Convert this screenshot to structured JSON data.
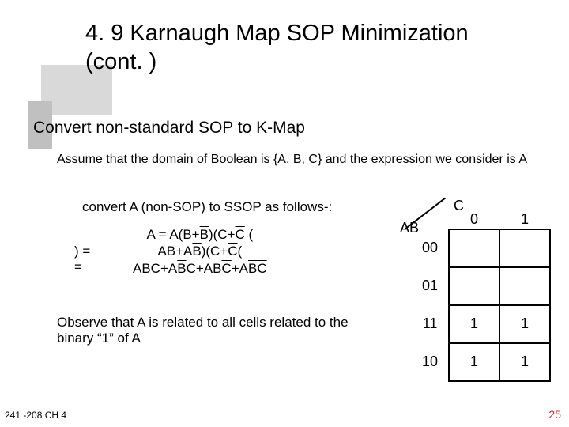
{
  "title": "4. 9 Karnaugh Map SOP Minimization (cont. )",
  "subtitle": "Convert non-standard SOP to K-Map",
  "assume": "Assume that the domain of Boolean is {A, B, C} and the expression we consider is A",
  "convert_line": "convert A (non-SOP) to SSOP as follows-:",
  "expansion": {
    "l1": ") = ",
    "l2": " =",
    "r_pre": "A = A(B+",
    "r_bar1": "B",
    "r_mid1": ")(C+",
    "r_bar2": "C",
    "r_mid15": " (",
    "r_line2a": "AB+A",
    "r_bar3": "B",
    "r_line2b": ")(C+",
    "r_bar4": "C",
    "r_line2c": "(",
    "r_line3a": "ABC+A",
    "r_bar5": "B",
    "r_line3b": "C+AB",
    "r_bar6": "C",
    "r_line3c": "+A",
    "r_bar7": "B",
    "r_bar8": "C"
  },
  "observe_pre": "Observe that A is related to all cells related to the binary “",
  "observe_one": "1",
  "observe_post": "” of A",
  "footer_left": "241 -208 CH 4",
  "footer_right": "25",
  "kmap": {
    "corner_c": "C",
    "corner_ab": "AB",
    "col0": "0",
    "col1": "1",
    "rows": [
      "00",
      "01",
      "11",
      "10"
    ],
    "cells": [
      [
        "",
        ""
      ],
      [
        "",
        ""
      ],
      [
        "1",
        "1"
      ],
      [
        "1",
        "1"
      ]
    ]
  }
}
